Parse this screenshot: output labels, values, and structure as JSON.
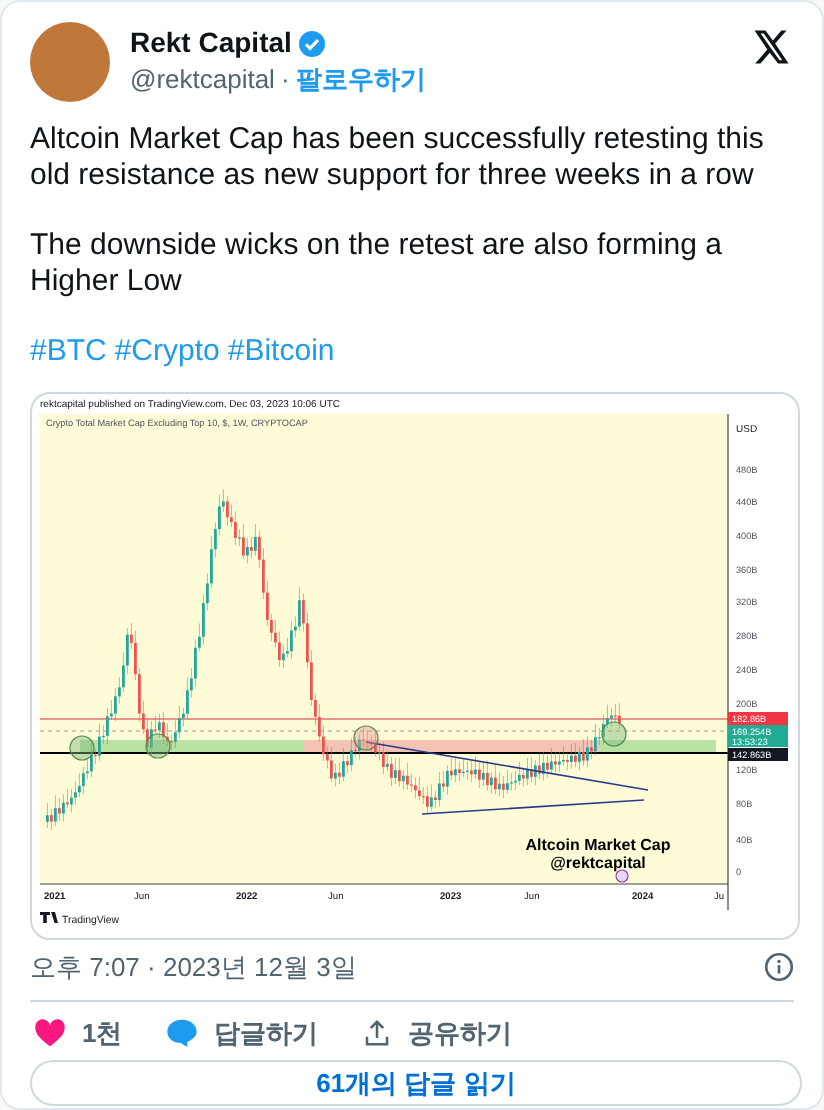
{
  "author": {
    "name": "Rekt Capital",
    "verified": true,
    "handle": "@rektcapital",
    "separator": "·",
    "follow": "팔로우하기"
  },
  "body": {
    "paragraphs": [
      "Altcoin Market Cap has been successfully retesting this old resistance as new support for three weeks in a row",
      "The downside wicks on the retest are also forming a Higher Low"
    ],
    "hashtags": [
      "#BTC",
      "#Crypto",
      "#Bitcoin"
    ]
  },
  "chart_image": {
    "published": "rektcapital published on TradingView.com, Dec 03, 2023 10:06 UTC",
    "symbol": "Crypto Total Market Cap Excluding Top 10, $, 1W, CRYPTOCAP",
    "currency": "USD",
    "y_ticks": [
      "480B",
      "440B",
      "400B",
      "360B",
      "320B",
      "280B",
      "240B",
      "200B",
      "120B",
      "80B",
      "40B",
      "0"
    ],
    "price_tags": [
      {
        "text": "182.86B",
        "color": "#f23645"
      },
      {
        "text": "169.254B",
        "sub": "13:53:23",
        "color": "#22ab94"
      },
      {
        "text": "142.863B",
        "color": "#131722"
      }
    ],
    "x_labels": [
      "2021",
      "Jun",
      "2022",
      "Jun",
      "2023",
      "Jun",
      "2024",
      "Ju"
    ],
    "annotation": [
      "Altcoin Market Cap",
      "@rektcapital"
    ],
    "brand": "TradingView"
  },
  "timestamp": "오후 7:07 · 2023년 12월 3일",
  "actions": [
    {
      "kind": "like",
      "label": "1천"
    },
    {
      "kind": "reply",
      "label": "답글하기"
    },
    {
      "kind": "share",
      "label": "공유하기"
    }
  ],
  "read_replies": "61개의 답글 읽기"
}
